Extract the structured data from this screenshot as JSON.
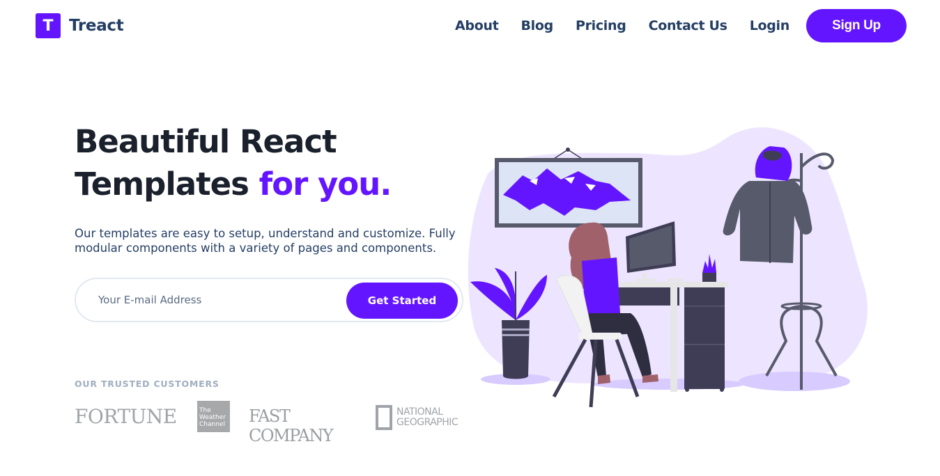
{
  "brand": {
    "logo_letter": "T",
    "name": "Treact"
  },
  "nav": {
    "links": [
      "About",
      "Blog",
      "Pricing",
      "Contact Us",
      "Login"
    ],
    "signup_label": "Sign Up"
  },
  "hero": {
    "title_line1": "Beautiful React",
    "title_line2_main": "Templates ",
    "title_line2_accent": "for you.",
    "description": "Our templates are easy to setup, understand and customize. Fully modular components with a variety of pages and components."
  },
  "form": {
    "email_placeholder": "Your E-mail Address",
    "submit_label": "Get Started"
  },
  "customers": {
    "label": "OUR TRUSTED CUSTOMERS",
    "logos": {
      "fortune": "FORTUNE",
      "weather": [
        "The",
        "Weather",
        "Channel"
      ],
      "fastcompany": "FAST COMPANY",
      "natgeo": [
        "NATIONAL",
        "GEOGRAPHIC"
      ]
    }
  },
  "colors": {
    "primary": "#6415ff",
    "heading": "#1a202c",
    "nav_text": "#243e63",
    "muted": "#a0aec0",
    "blob": "#ede5ff"
  }
}
